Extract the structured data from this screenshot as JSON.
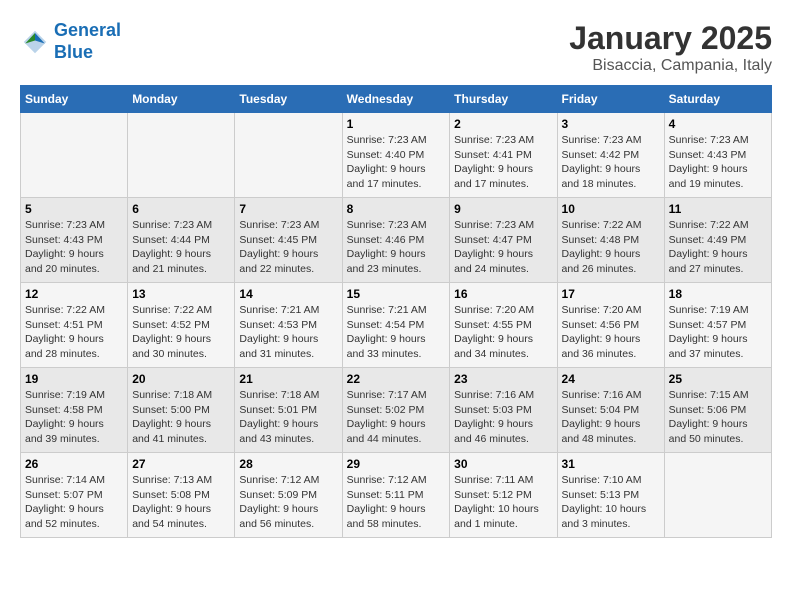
{
  "header": {
    "logo_line1": "General",
    "logo_line2": "Blue",
    "month": "January 2025",
    "location": "Bisaccia, Campania, Italy"
  },
  "weekdays": [
    "Sunday",
    "Monday",
    "Tuesday",
    "Wednesday",
    "Thursday",
    "Friday",
    "Saturday"
  ],
  "weeks": [
    [
      {
        "day": "",
        "info": ""
      },
      {
        "day": "",
        "info": ""
      },
      {
        "day": "",
        "info": ""
      },
      {
        "day": "1",
        "info": "Sunrise: 7:23 AM\nSunset: 4:40 PM\nDaylight: 9 hours\nand 17 minutes."
      },
      {
        "day": "2",
        "info": "Sunrise: 7:23 AM\nSunset: 4:41 PM\nDaylight: 9 hours\nand 17 minutes."
      },
      {
        "day": "3",
        "info": "Sunrise: 7:23 AM\nSunset: 4:42 PM\nDaylight: 9 hours\nand 18 minutes."
      },
      {
        "day": "4",
        "info": "Sunrise: 7:23 AM\nSunset: 4:43 PM\nDaylight: 9 hours\nand 19 minutes."
      }
    ],
    [
      {
        "day": "5",
        "info": "Sunrise: 7:23 AM\nSunset: 4:43 PM\nDaylight: 9 hours\nand 20 minutes."
      },
      {
        "day": "6",
        "info": "Sunrise: 7:23 AM\nSunset: 4:44 PM\nDaylight: 9 hours\nand 21 minutes."
      },
      {
        "day": "7",
        "info": "Sunrise: 7:23 AM\nSunset: 4:45 PM\nDaylight: 9 hours\nand 22 minutes."
      },
      {
        "day": "8",
        "info": "Sunrise: 7:23 AM\nSunset: 4:46 PM\nDaylight: 9 hours\nand 23 minutes."
      },
      {
        "day": "9",
        "info": "Sunrise: 7:23 AM\nSunset: 4:47 PM\nDaylight: 9 hours\nand 24 minutes."
      },
      {
        "day": "10",
        "info": "Sunrise: 7:22 AM\nSunset: 4:48 PM\nDaylight: 9 hours\nand 26 minutes."
      },
      {
        "day": "11",
        "info": "Sunrise: 7:22 AM\nSunset: 4:49 PM\nDaylight: 9 hours\nand 27 minutes."
      }
    ],
    [
      {
        "day": "12",
        "info": "Sunrise: 7:22 AM\nSunset: 4:51 PM\nDaylight: 9 hours\nand 28 minutes."
      },
      {
        "day": "13",
        "info": "Sunrise: 7:22 AM\nSunset: 4:52 PM\nDaylight: 9 hours\nand 30 minutes."
      },
      {
        "day": "14",
        "info": "Sunrise: 7:21 AM\nSunset: 4:53 PM\nDaylight: 9 hours\nand 31 minutes."
      },
      {
        "day": "15",
        "info": "Sunrise: 7:21 AM\nSunset: 4:54 PM\nDaylight: 9 hours\nand 33 minutes."
      },
      {
        "day": "16",
        "info": "Sunrise: 7:20 AM\nSunset: 4:55 PM\nDaylight: 9 hours\nand 34 minutes."
      },
      {
        "day": "17",
        "info": "Sunrise: 7:20 AM\nSunset: 4:56 PM\nDaylight: 9 hours\nand 36 minutes."
      },
      {
        "day": "18",
        "info": "Sunrise: 7:19 AM\nSunset: 4:57 PM\nDaylight: 9 hours\nand 37 minutes."
      }
    ],
    [
      {
        "day": "19",
        "info": "Sunrise: 7:19 AM\nSunset: 4:58 PM\nDaylight: 9 hours\nand 39 minutes."
      },
      {
        "day": "20",
        "info": "Sunrise: 7:18 AM\nSunset: 5:00 PM\nDaylight: 9 hours\nand 41 minutes."
      },
      {
        "day": "21",
        "info": "Sunrise: 7:18 AM\nSunset: 5:01 PM\nDaylight: 9 hours\nand 43 minutes."
      },
      {
        "day": "22",
        "info": "Sunrise: 7:17 AM\nSunset: 5:02 PM\nDaylight: 9 hours\nand 44 minutes."
      },
      {
        "day": "23",
        "info": "Sunrise: 7:16 AM\nSunset: 5:03 PM\nDaylight: 9 hours\nand 46 minutes."
      },
      {
        "day": "24",
        "info": "Sunrise: 7:16 AM\nSunset: 5:04 PM\nDaylight: 9 hours\nand 48 minutes."
      },
      {
        "day": "25",
        "info": "Sunrise: 7:15 AM\nSunset: 5:06 PM\nDaylight: 9 hours\nand 50 minutes."
      }
    ],
    [
      {
        "day": "26",
        "info": "Sunrise: 7:14 AM\nSunset: 5:07 PM\nDaylight: 9 hours\nand 52 minutes."
      },
      {
        "day": "27",
        "info": "Sunrise: 7:13 AM\nSunset: 5:08 PM\nDaylight: 9 hours\nand 54 minutes."
      },
      {
        "day": "28",
        "info": "Sunrise: 7:12 AM\nSunset: 5:09 PM\nDaylight: 9 hours\nand 56 minutes."
      },
      {
        "day": "29",
        "info": "Sunrise: 7:12 AM\nSunset: 5:11 PM\nDaylight: 9 hours\nand 58 minutes."
      },
      {
        "day": "30",
        "info": "Sunrise: 7:11 AM\nSunset: 5:12 PM\nDaylight: 10 hours\nand 1 minute."
      },
      {
        "day": "31",
        "info": "Sunrise: 7:10 AM\nSunset: 5:13 PM\nDaylight: 10 hours\nand 3 minutes."
      },
      {
        "day": "",
        "info": ""
      }
    ]
  ]
}
